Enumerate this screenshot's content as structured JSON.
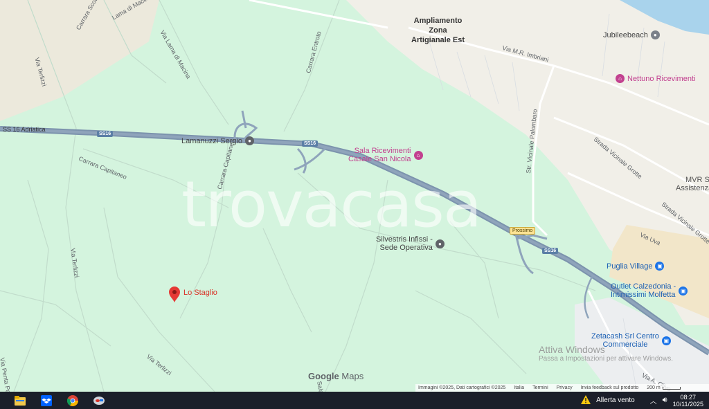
{
  "map": {
    "area_labels": [
      "Ampliamento",
      "Zona",
      "Artigianale Est"
    ],
    "roads": {
      "ss16_adriatica": "SS 16 Adriatica",
      "carrara_scotella": "Carrara Scotella",
      "lama_di_macina": "Lama di Macina",
      "via_lama_di_macina": "Via Lama di Macina",
      "carrara_entroto": "Carrara Entroto",
      "via_terlizzi_top": "Via Terlizzi",
      "via_terlizzi_mid": "Via Terlizzi",
      "via_terlizzi_bottom": "Via Terlizzi",
      "carrara_capitaneo": "Carrara Capitaneo",
      "carrara_capitaneo_2": "Carrara Capitaneo",
      "via_mr_imbriani": "Via M.R. Imbriani",
      "str_vicinale_palombaro": "Str. Vicinale Palombaro",
      "strada_vicinale_grotte_1": "Strada Vicinale Grotte",
      "strada_vicinale_grotte_2": "Strada Vicinale Grotte",
      "via_uva": "Via Uva",
      "via_penta_palo": "Via Penta Palo",
      "via_a_olivo": "Via A. Olivo",
      "salas": "Salas"
    },
    "shields": [
      "SS16",
      "SS16",
      "SS16"
    ],
    "prossimo": "Prossimo",
    "pois": {
      "jubileebeach": "Jubileebeach",
      "nettuno": "Nettuno Ricevimenti",
      "lamanuzzi": "Lamanuzzi Sergio",
      "sala_line1": "Sala Ricevimenti",
      "sala_line2": "Casale San Nicola",
      "mvr_line1": "MVR S",
      "mvr_line2": "Assistenza, Ripa",
      "silvestris_line1": "Silvestris Infissi -",
      "silvestris_line2": "Sede Operativa",
      "puglia_village": "Puglia Village",
      "outlet_line1": "Outlet Calzedonia -",
      "outlet_line2": "Intimissimi Molfetta",
      "zetacash_line1": "Zetacash Srl Centro",
      "zetacash_line2": "Commerciale",
      "lo_staglio": "Lo Staglio"
    },
    "watermark": "trovacasa",
    "activate_windows": {
      "title": "Attiva Windows",
      "subtitle": "Passa a Impostazioni per attivare Windows."
    },
    "google_maps": {
      "google": "Google",
      "maps": "Maps"
    },
    "attribution": {
      "imagery": "Immagini ©2025, Dati cartografici ©2025",
      "country": "Italia",
      "terms": "Termini",
      "privacy": "Privacy",
      "feedback": "Invia feedback sul prodotto",
      "scale": "200 m"
    },
    "colors": {
      "land": "#d4f4de",
      "urban": "#f1efe8",
      "sea": "#a9d3ec",
      "highway": "#7c93ad",
      "pin_red": "#e53935",
      "poi_pink": "#c2408f",
      "poi_blue": "#1a73e8"
    }
  },
  "taskbar": {
    "icons": [
      "file-explorer-icon",
      "dropbox-icon",
      "chrome-icon",
      "app-icon"
    ],
    "notification": "Allerta vento",
    "time": "08:27",
    "date": "10/11/2025"
  }
}
